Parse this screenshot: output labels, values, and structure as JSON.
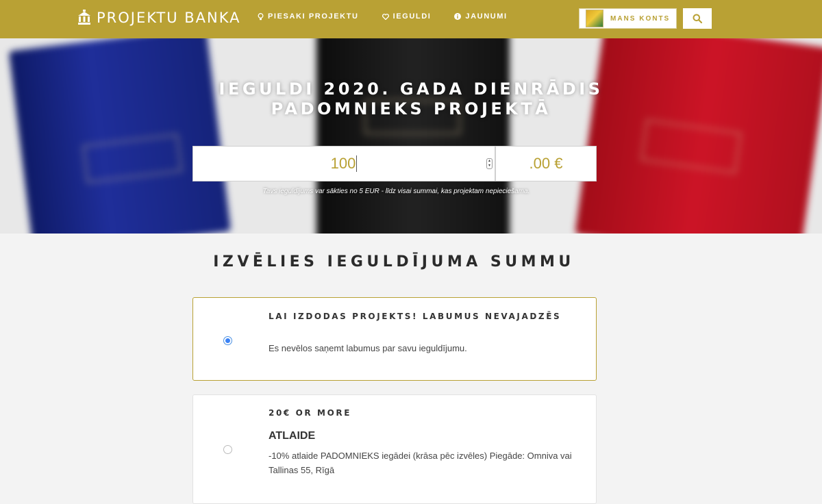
{
  "header": {
    "logo_text": "PROJEKTU BANKA",
    "nav": [
      {
        "label": "PIESAKI PROJEKTU",
        "icon": "lightbulb-icon"
      },
      {
        "label": "IEGULDI",
        "icon": "heart-icon"
      },
      {
        "label": "JAUNUMI",
        "icon": "info-icon"
      }
    ],
    "account_label": "MANS KONTS",
    "search_icon": "search-icon"
  },
  "hero": {
    "title_line1": "IEGULDI 2020. GADA DIENRĀDIS",
    "title_line2": "PADOMNIEKS PROJEKTĀ",
    "amount_value": "100",
    "cents": ".00 €",
    "note": "Tavs ieguldījums var sākties no 5 EUR - līdz visai summai, kas projektam nepieciešama."
  },
  "main": {
    "section_title": "IZVĒLIES IEGULDĪJUMA SUMMU",
    "rewards": [
      {
        "title": "LAI IZDODAS PROJEKTS! LABUMUS NEVAJADZĒS",
        "subtitle": "",
        "description": "Es nevēlos saņemt labumus par savu ieguldījumu.",
        "selected": true
      },
      {
        "title": "20€ OR MORE",
        "subtitle": "ATLAIDE",
        "description": "-10% atlaide PADOMNIEKS iegādei (krāsa pēc izvēles) Piegāde: Omniva vai Tallinas 55, Rīgā",
        "selected": false
      }
    ]
  },
  "colors": {
    "brand": "#b9a134",
    "radio_selected": "#3b82f6"
  }
}
